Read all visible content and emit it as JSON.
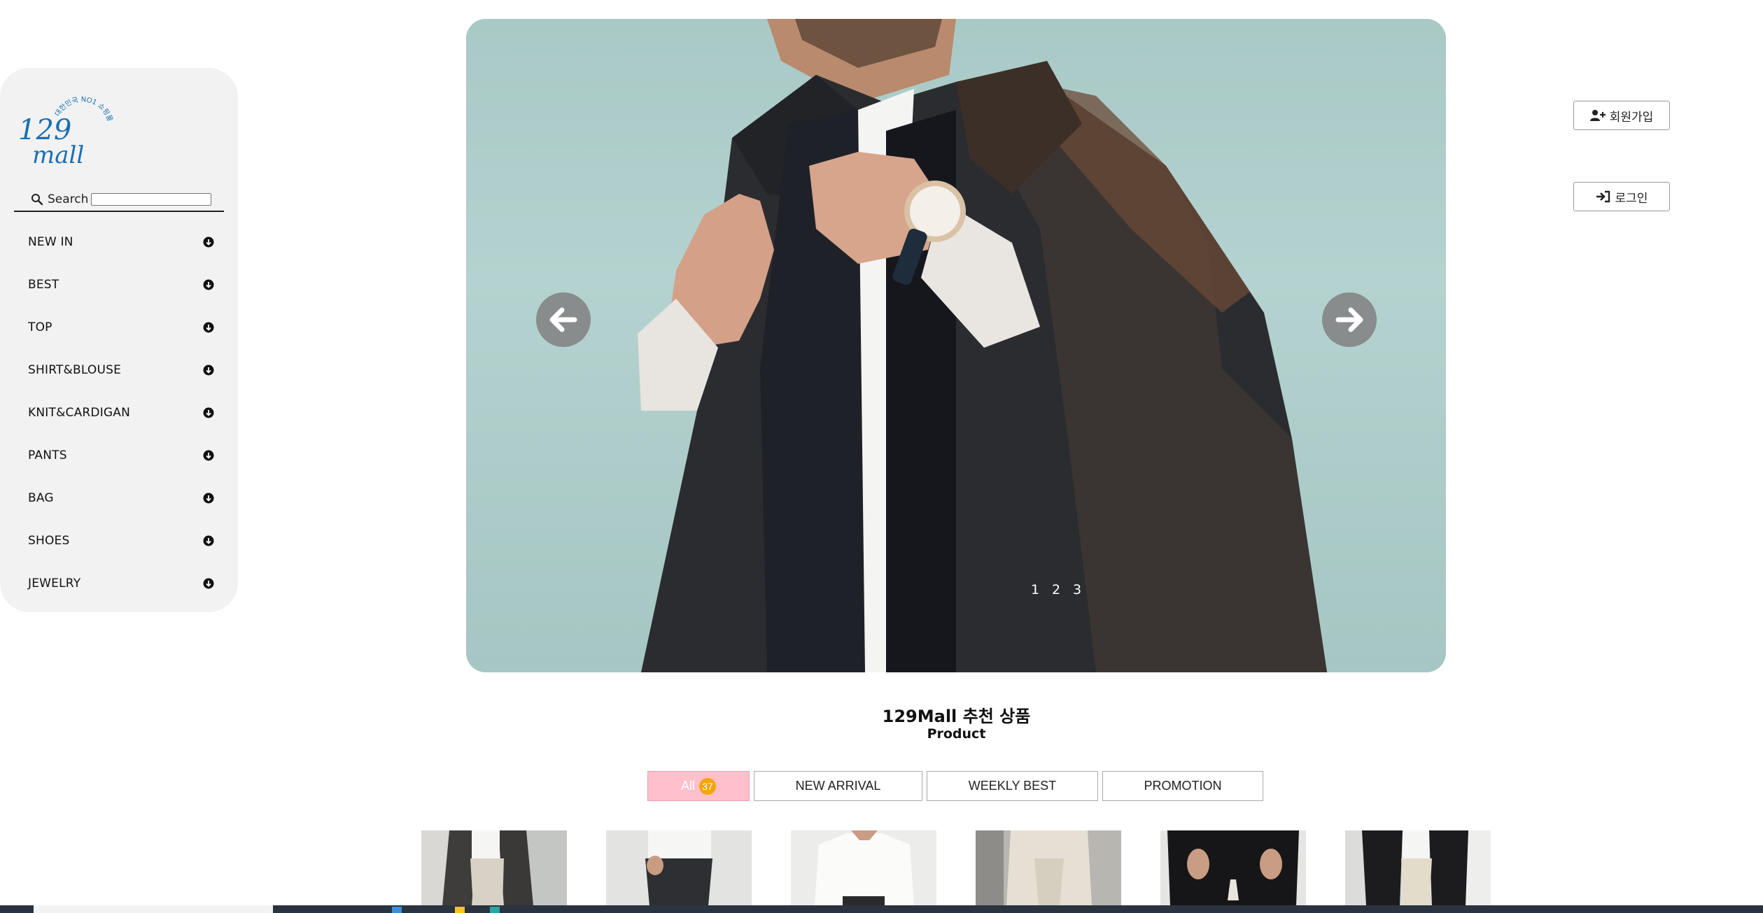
{
  "sidebar": {
    "logo": {
      "main": "129 mall",
      "arc": "대한민국 NO1 쇼핑몰"
    },
    "search": {
      "label": "Search",
      "placeholder": ""
    },
    "menu": [
      {
        "label": "NEW IN"
      },
      {
        "label": "BEST"
      },
      {
        "label": "TOP"
      },
      {
        "label": "SHIRT&BLOUSE"
      },
      {
        "label": "KNIT&CARDIGAN"
      },
      {
        "label": "PANTS"
      },
      {
        "label": "BAG"
      },
      {
        "label": "SHOES"
      },
      {
        "label": "JEWELRY"
      }
    ]
  },
  "hero": {
    "pages": [
      "1",
      "2",
      "3"
    ],
    "prev_icon": "arrow-left-icon",
    "next_icon": "arrow-right-icon"
  },
  "auth": {
    "signup_label": "회원가입",
    "login_label": "로그인"
  },
  "section": {
    "title": "129Mall 추천 상품",
    "subtitle": "Product"
  },
  "tabs": {
    "all_label": "All",
    "all_count": "37",
    "new_arrival": "NEW ARRIVAL",
    "weekly_best": "WEEKLY BEST",
    "promotion": "PROMOTION"
  },
  "colors": {
    "tab_active_bg": "#ffc0cb",
    "badge": "#f5a500",
    "sidebar_bg": "#f2f2f2",
    "logo_blue": "#1a6fb5"
  }
}
